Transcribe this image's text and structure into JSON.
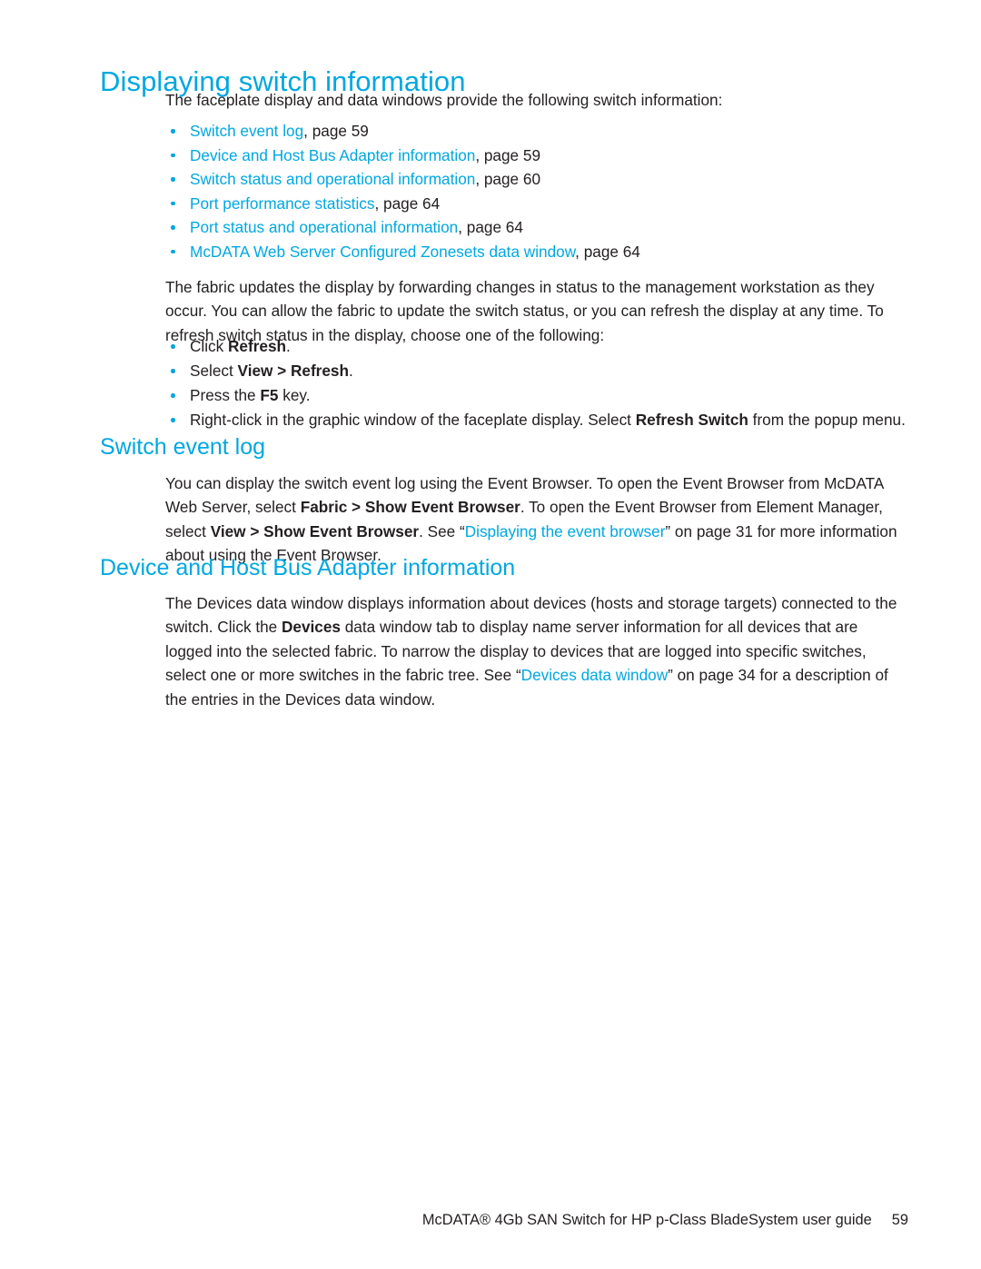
{
  "colors": {
    "heading_blue": "#00a7e1",
    "link_blue": "#00a7e1",
    "body_black": "#231f20",
    "page_background": "#ffffff"
  },
  "page_title": "Displaying switch information",
  "intro_paragraph": "The faceplate display and data windows provide the following switch information:",
  "topic_list": [
    {
      "link": "Switch event log",
      "suffix": ", page 59"
    },
    {
      "link": "Device and Host Bus Adapter information",
      "suffix": ", page 59"
    },
    {
      "link": "Switch status and operational information",
      "suffix": ", page 60"
    },
    {
      "link": "Port performance statistics",
      "suffix": ", page 64"
    },
    {
      "link": "Port status and operational information",
      "suffix": ", page 64"
    },
    {
      "link": "McDATA Web Server Configured Zonesets data window",
      "suffix": ", page 64"
    }
  ],
  "fabric_paragraph": "The fabric updates the display by forwarding changes in status to the management workstation as they occur. You can allow the fabric to update the switch status, or you can refresh the display at any time. To refresh switch status in the display, choose one of the following:",
  "refresh_list": [
    {
      "pre": "Click ",
      "bold": "Refresh",
      "post": "."
    },
    {
      "pre": "Select ",
      "bold": "View > Refresh",
      "post": "."
    },
    {
      "pre": "Press the ",
      "bold": "F5",
      "post": " key."
    },
    {
      "pre": "Right-click in the graphic window of the faceplate display. Select ",
      "bold": "Refresh Switch",
      "post": " from the popup menu."
    }
  ],
  "sections": [
    {
      "heading": "Switch event log",
      "paragraph": {
        "p1": "You can display the switch event log using the Event Browser. To open the Event Browser from McDATA Web Server, select ",
        "b1": "Fabric > Show Event Browser",
        "p2": ". To open the Event Browser from Element Manager, select ",
        "b2": "View > Show Event Browser",
        "p3": ". See “",
        "link": "Displaying the event browser",
        "p4": "” on page 31 for more information about using the Event Browser."
      }
    },
    {
      "heading": "Device and Host Bus Adapter information",
      "paragraph": {
        "p1": "The Devices data window displays information about devices (hosts and storage targets) connected to the switch. Click the ",
        "b1": "Devices",
        "p2": " data window tab to display name server information for all devices that are logged into the selected fabric. To narrow the display to devices that are logged into specific switches, select one or more switches in the fabric tree. See “",
        "link": "Devices data window",
        "p3": "” on page 34 for a description of the entries in the Devices data window."
      }
    }
  ],
  "footer": {
    "guide_title": "McDATA® 4Gb SAN Switch for HP p-Class BladeSystem user guide",
    "page_number": "59"
  }
}
